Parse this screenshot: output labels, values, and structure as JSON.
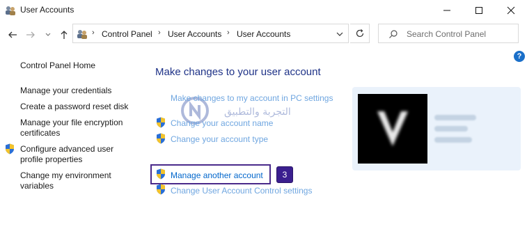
{
  "window": {
    "title": "User Accounts",
    "icon": "users-icon",
    "controls": [
      "minimize-icon",
      "maximize-icon",
      "close-icon"
    ]
  },
  "nav": {
    "back_icon": "arrow-left-icon",
    "forward_icon": "arrow-right-icon",
    "recent_icon": "chevron-down-icon",
    "up_icon": "arrow-up-icon",
    "breadcrumbs": [
      "Control Panel",
      "User Accounts",
      "User Accounts"
    ],
    "refresh_icon": "refresh-icon",
    "search_placeholder": "Search Control Panel"
  },
  "help_label": "?",
  "sidebar": {
    "home": "Control Panel Home",
    "items": [
      {
        "label": "Manage your credentials",
        "shield": false
      },
      {
        "label": "Create a password reset disk",
        "shield": false
      },
      {
        "label": "Manage your file encryption certificates",
        "shield": false
      },
      {
        "label": "Configure advanced user profile properties",
        "shield": true
      },
      {
        "label": "Change my environment variables",
        "shield": false
      }
    ]
  },
  "main": {
    "title": "Make changes to your user account",
    "links": [
      {
        "label": "Make changes to my account in PC settings",
        "shield": false
      },
      {
        "label": "Change your account name",
        "shield": true
      },
      {
        "label": "Change your account type",
        "shield": true
      },
      {
        "label": "Manage another account",
        "shield": true
      },
      {
        "label": "Change User Account Control settings",
        "shield": true
      }
    ]
  },
  "annotation": {
    "step": "3",
    "color": "#3b1f8f"
  },
  "watermark": {
    "arabic": "التجربة والتطبيق"
  },
  "colors": {
    "link": "#0066cc",
    "title": "#1e3287",
    "accent": "#1a6fc9"
  }
}
